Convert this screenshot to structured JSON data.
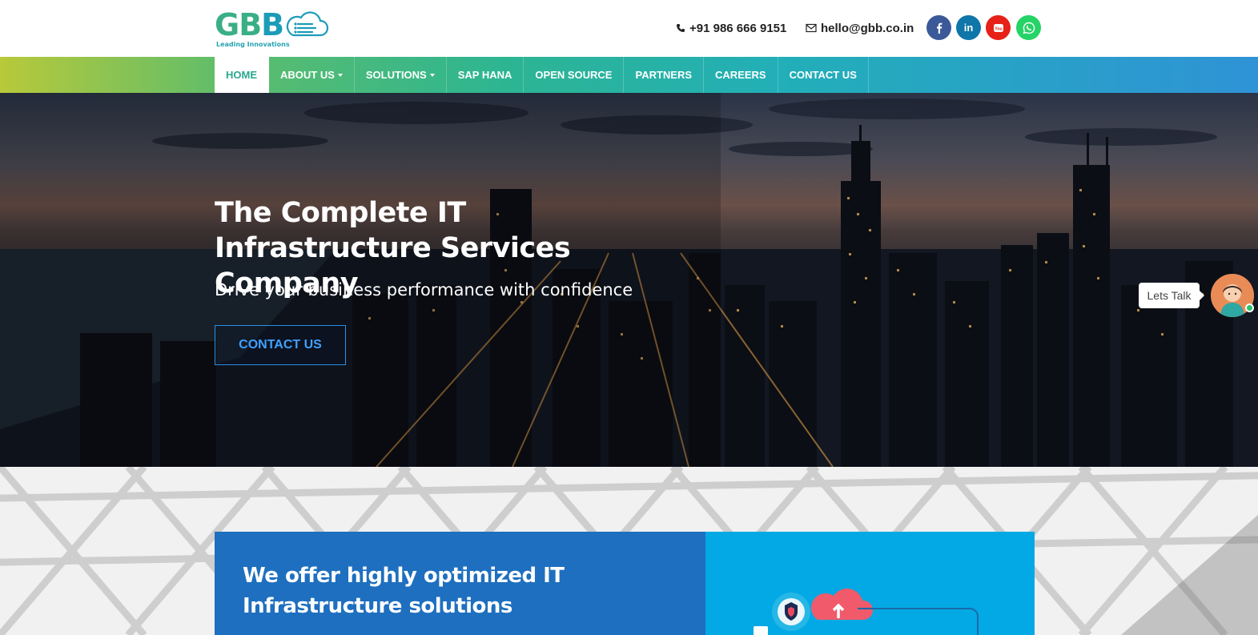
{
  "brand": {
    "name_part1": "GB",
    "name_part2": "B",
    "tagline": "Leading Innovations"
  },
  "contact": {
    "phone": "+91 986 666 9151",
    "email": "hello@gbb.co.in"
  },
  "social": [
    {
      "name": "facebook",
      "glyph": "f",
      "color": "#3b5998"
    },
    {
      "name": "linkedin",
      "glyph": "in",
      "color": "#0e76a8"
    },
    {
      "name": "youtube",
      "glyph": "You",
      "color": "#e62117"
    },
    {
      "name": "whatsapp",
      "glyph": "",
      "color": "#25d366"
    }
  ],
  "nav": {
    "items": [
      {
        "label": "HOME",
        "active": true,
        "dropdown": false
      },
      {
        "label": "ABOUT US",
        "active": false,
        "dropdown": true
      },
      {
        "label": "SOLUTIONS",
        "active": false,
        "dropdown": true
      },
      {
        "label": "SAP HANA",
        "active": false,
        "dropdown": false
      },
      {
        "label": "OPEN SOURCE",
        "active": false,
        "dropdown": false
      },
      {
        "label": "PARTNERS",
        "active": false,
        "dropdown": false
      },
      {
        "label": "CAREERS",
        "active": false,
        "dropdown": false
      },
      {
        "label": "CONTACT US",
        "active": false,
        "dropdown": false
      }
    ]
  },
  "hero": {
    "title": "The Complete IT Infrastructure Services Company",
    "subtitle": "Drive your business performance with confidence",
    "cta_label": "CONTACT US"
  },
  "chat": {
    "label": "Lets Talk"
  },
  "offer": {
    "heading": "We offer highly optimized IT Infrastructure solutions"
  }
}
